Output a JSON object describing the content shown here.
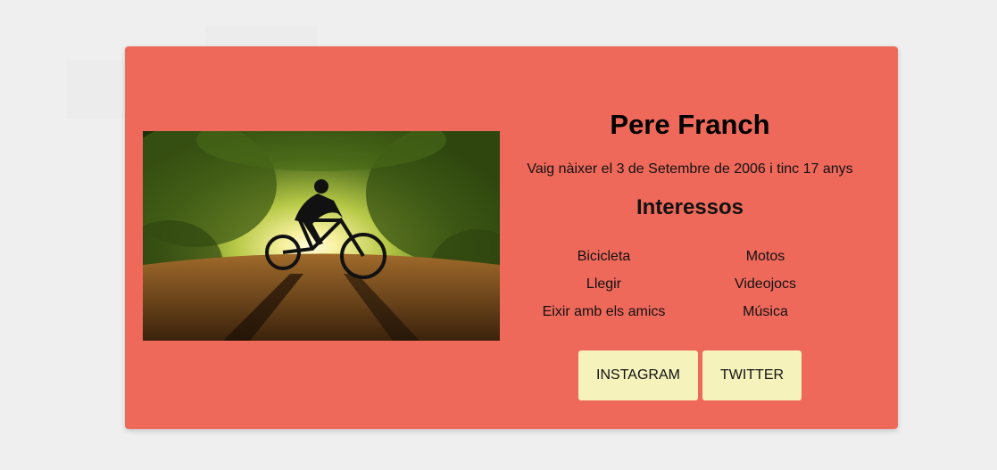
{
  "profile": {
    "name": "Pere Franch",
    "bio": "Vaig nàixer el 3 de Setembre de 2006 i tinc 17 anys",
    "interests_title": "Interessos",
    "interests": [
      "Bicicleta",
      "Motos",
      "Llegir",
      "Videojocs",
      "Eixir amb els amics",
      "Música"
    ],
    "photo_icon": "mountain-biker-photo"
  },
  "buttons": {
    "instagram": "INSTAGRAM",
    "twitter": "TWITTER"
  },
  "colors": {
    "card": "#ef695b",
    "button": "#f6f2bc",
    "background": "#efefef"
  }
}
